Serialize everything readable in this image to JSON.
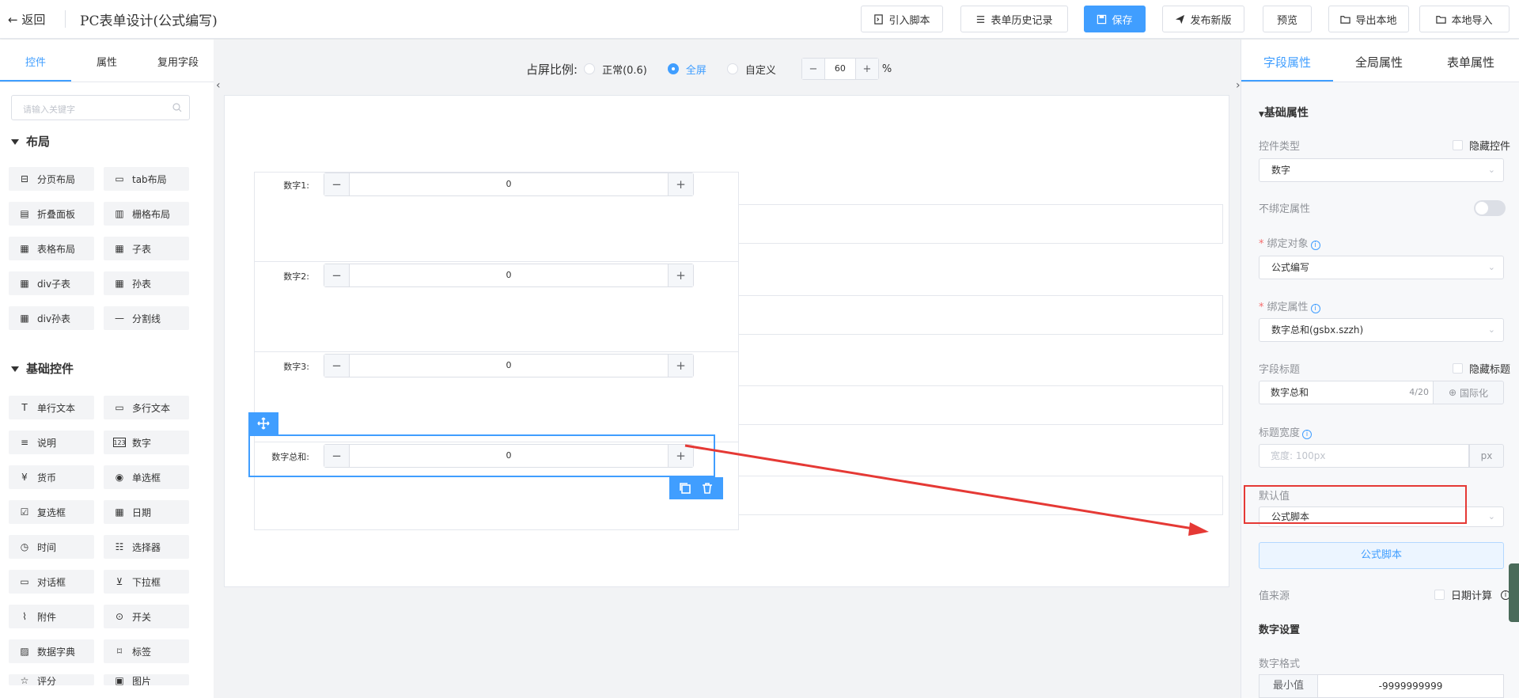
{
  "header": {
    "back_label": "返回",
    "title": "PC表单设计(公式编写)",
    "buttons": {
      "import_script": "引入脚本",
      "history": "表单历史记录",
      "save": "保存",
      "publish": "发布新版",
      "preview": "预览",
      "export_local": "导出本地",
      "import_local": "本地导入"
    }
  },
  "left": {
    "tabs": [
      "控件",
      "属性",
      "复用字段"
    ],
    "search_placeholder": "请输入关键字",
    "layout_section": "布局",
    "layout_items": [
      "分页布局",
      "tab布局",
      "折叠面板",
      "栅格布局",
      "表格布局",
      "子表",
      "div子表",
      "孙表",
      "div孙表",
      "分割线"
    ],
    "basic_section": "基础控件",
    "basic_items": [
      "单行文本",
      "多行文本",
      "说明",
      "数字",
      "货币",
      "单选框",
      "复选框",
      "日期",
      "时间",
      "选择器",
      "对话框",
      "下拉框",
      "附件",
      "开关",
      "数据字典",
      "标签",
      "评分",
      "图片"
    ]
  },
  "canvas": {
    "ratio_label": "占屏比例:",
    "ratio_options": [
      "正常(0.6)",
      "全屏",
      "自定义"
    ],
    "ratio_selected": "全屏",
    "zoom_value": "60",
    "zoom_unit": "%",
    "fields": [
      {
        "label": "数字1:",
        "value": "0"
      },
      {
        "label": "数字2:",
        "value": "0"
      },
      {
        "label": "数字3:",
        "value": "0"
      },
      {
        "label": "数字总和:",
        "value": "0"
      }
    ]
  },
  "right": {
    "tabs": [
      "字段属性",
      "全局属性",
      "表单属性"
    ],
    "section_basic": "基础属性",
    "control_type_label": "控件类型",
    "hide_control_label": "隐藏控件",
    "control_type_value": "数字",
    "unbind_label": "不绑定属性",
    "bind_object_label": "绑定对象",
    "bind_object_value": "公式编写",
    "bind_prop_label": "绑定属性",
    "bind_prop_value": "数字总和(gsbx.szzh)",
    "field_title_label": "字段标题",
    "hide_title_label": "隐藏标题",
    "field_title_value": "数字总和",
    "field_title_count": "4/20",
    "i18n_label": "国际化",
    "title_width_label": "标题宽度",
    "title_width_placeholder": "宽度: 100px",
    "px_unit": "px",
    "default_value_label": "默认值",
    "default_value_value": "公式脚本",
    "formula_script_button": "公式脚本",
    "value_source_label": "值来源",
    "date_calc_label": "日期计算",
    "number_settings": "数字设置",
    "number_format_label": "数字格式",
    "min_label": "最小值",
    "min_value": "-9999999999"
  },
  "colors": {
    "primary": "#409eff",
    "annotation_red": "#e53935"
  }
}
